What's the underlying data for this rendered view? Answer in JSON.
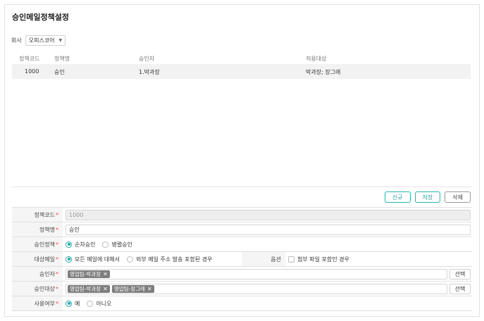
{
  "page": {
    "title": "승인메일정책설정"
  },
  "company": {
    "label": "회사",
    "value": "오피스코어"
  },
  "list": {
    "columns": [
      "정책코드",
      "정책명",
      "승인자",
      "적용대상"
    ],
    "rows": [
      {
        "code": "1000",
        "name": "승인",
        "approver": "1.박과장",
        "target": "박과장; 장그래"
      }
    ]
  },
  "actions": {
    "new": "신규",
    "save": "저장",
    "delete": "삭제"
  },
  "form": {
    "code": {
      "label": "정책코드",
      "value": "1000"
    },
    "name": {
      "label": "정책명",
      "value": "승인"
    },
    "policy": {
      "label": "승인정책",
      "options": [
        "순차승인",
        "병렬승인"
      ],
      "selected": "순차승인"
    },
    "mail": {
      "label": "대상메일",
      "options": [
        "모든 메일에 대해서",
        "외부 메일 주소 발송 포함된 경우"
      ],
      "selected": "모든 메일에 대해서"
    },
    "option": {
      "label": "옵션",
      "checkbox": "첨부 파일 포함인 경우",
      "checked": false
    },
    "approver": {
      "label": "승인자",
      "tags": [
        "영업팀-박과장"
      ],
      "select": "선택"
    },
    "target": {
      "label": "승인대상",
      "tags": [
        "영업팀-박과장",
        "영업팀-장그래"
      ],
      "select": "선택"
    },
    "use": {
      "label": "사용여부",
      "options": [
        "예",
        "아니오"
      ],
      "selected": "예"
    }
  },
  "colors": {
    "accent": "#1fa9a6",
    "required": "#e05050",
    "tag": "#7d7d7d"
  },
  "icons": {
    "dropdown": "caret-down-icon",
    "remove": "close-icon"
  }
}
